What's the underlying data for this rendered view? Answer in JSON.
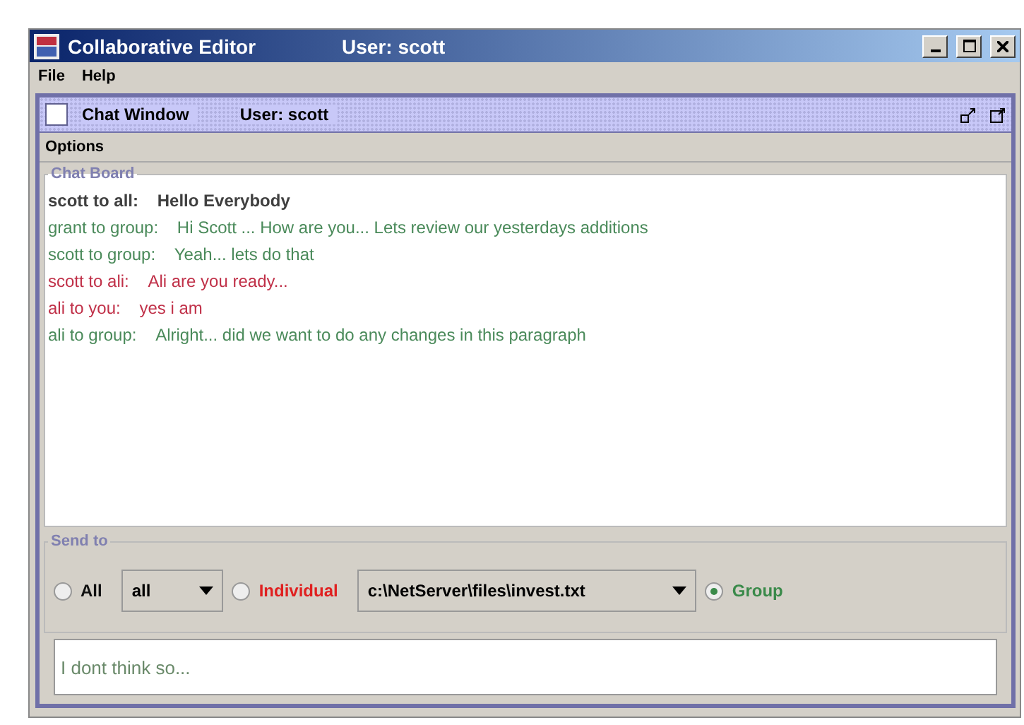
{
  "window": {
    "title": "Collaborative Editor",
    "user": "User: scott"
  },
  "menu": [
    "File",
    "Help"
  ],
  "chat_window": {
    "title": "Chat Window",
    "user": "User: scott",
    "menu": [
      "Options"
    ],
    "board": {
      "title": "Chat Board",
      "messages": [
        {
          "sender": "scott to all:",
          "text": "Hello Everybody",
          "color": "#404040"
        },
        {
          "sender": "grant to group:",
          "text": "Hi Scott ... How are you... Lets review our yesterdays additions",
          "color": "#4a8a5a"
        },
        {
          "sender": "scott to group:",
          "text": "Yeah... lets do that",
          "color": "#4a8a5a"
        },
        {
          "sender": "scott to ali:",
          "text": "Ali are you ready...",
          "color": "#c03048"
        },
        {
          "sender": "ali to you:",
          "text": "yes i am",
          "color": "#c03048"
        },
        {
          "sender": "ali to group:",
          "text": "Alright... did we want to do any changes in this paragraph",
          "color": "#4a8a5a"
        }
      ]
    },
    "send_to": {
      "title": "Send to",
      "options": [
        {
          "label": "All",
          "selected": false,
          "color": "#101010",
          "dropdown": "all"
        },
        {
          "label": "Individual",
          "selected": false,
          "color": "#e02020",
          "dropdown": "c:\\NetServer\\files\\invest.txt"
        },
        {
          "label": "Group",
          "selected": true,
          "color": "#3a8a4a"
        }
      ]
    },
    "input": {
      "value": "I dont think so..."
    }
  }
}
